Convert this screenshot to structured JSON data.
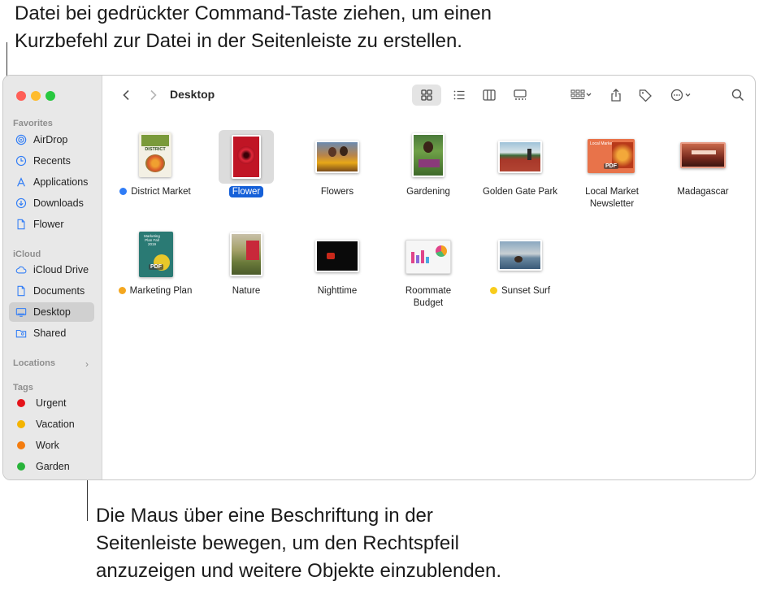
{
  "callouts": {
    "top_line1": "Datei bei gedrückter Command-Taste ziehen, um einen",
    "top_line2": "Kurzbefehl zur Datei in der Seitenleiste zu erstellen.",
    "bottom_line1": "Die Maus über eine Beschriftung in der",
    "bottom_line2": "Seitenleiste bewegen, um den Rechtspfeil",
    "bottom_line3": "anzuzeigen und weitere Objekte einzublenden."
  },
  "window": {
    "title": "Desktop",
    "traffic_colors": [
      "#ff5f57",
      "#febc2e",
      "#28c840"
    ]
  },
  "sidebar": {
    "favorites_label": "Favorites",
    "favorites": [
      {
        "label": "AirDrop",
        "icon": "airdrop-icon"
      },
      {
        "label": "Recents",
        "icon": "clock-icon"
      },
      {
        "label": "Applications",
        "icon": "applications-icon"
      },
      {
        "label": "Downloads",
        "icon": "download-icon"
      },
      {
        "label": "Flower",
        "icon": "document-icon"
      }
    ],
    "icloud_label": "iCloud",
    "icloud": [
      {
        "label": "iCloud Drive",
        "icon": "cloud-icon"
      },
      {
        "label": "Documents",
        "icon": "document-icon"
      },
      {
        "label": "Desktop",
        "icon": "desktop-icon",
        "selected": true
      },
      {
        "label": "Shared",
        "icon": "shared-folder-icon"
      }
    ],
    "locations_label": "Locations",
    "tags_label": "Tags",
    "tags": [
      {
        "label": "Urgent",
        "color": "#e5141b"
      },
      {
        "label": "Vacation",
        "color": "#f4b400"
      },
      {
        "label": "Work",
        "color": "#f47c0e"
      },
      {
        "label": "Garden",
        "color": "#28b33a"
      }
    ]
  },
  "files": [
    {
      "name": "District Market",
      "tag_color": "#2f7cf6"
    },
    {
      "name": "Flower",
      "selected": true
    },
    {
      "name": "Flowers"
    },
    {
      "name": "Gardening"
    },
    {
      "name": "Golden Gate Park"
    },
    {
      "name": "Local Market Newsletter",
      "line1": "Local Market",
      "line2": "Newsletter"
    },
    {
      "name": "Madagascar"
    },
    {
      "name": "Marketing Plan",
      "tag_color": "#f4a720"
    },
    {
      "name": "Nature"
    },
    {
      "name": "Nighttime"
    },
    {
      "name": "Roommate Budget",
      "line1": "Roommate",
      "line2": "Budget"
    },
    {
      "name": "Sunset Surf",
      "tag_color": "#f8cc1c"
    }
  ],
  "thumb_text": {
    "district": "DISTRICT",
    "pdf": "PDF",
    "local_market": "Local Market",
    "marketing": "Marketing Plan Fall 2019"
  }
}
